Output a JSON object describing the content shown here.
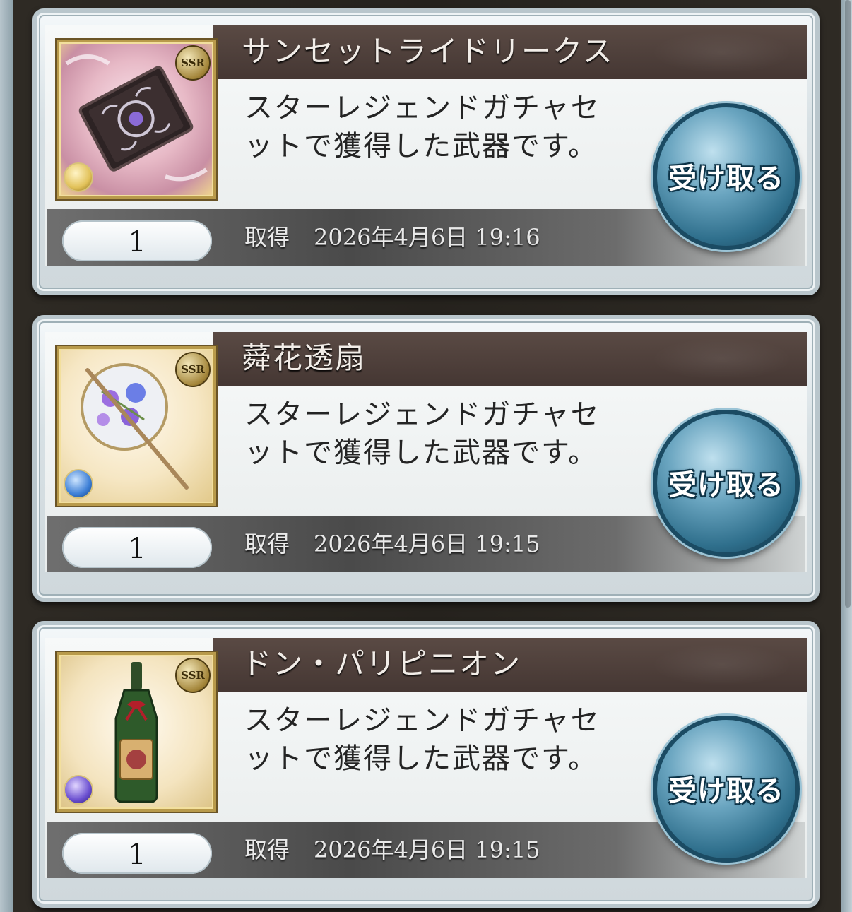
{
  "items": [
    {
      "name": "サンセットライドリークス",
      "description": "スターレジェンドガチャセットで獲得した武器です。",
      "quantity": "1",
      "obtained_label": "取得",
      "obtained_datetime": "2026年4月6日 19:16",
      "rarity": "SSR",
      "element_color": "#e2c25a",
      "icon": "book-icon",
      "button_label": "受け取る"
    },
    {
      "name": "蕣花透扇",
      "description": "スターレジェンドガチャセットで獲得した武器です。",
      "quantity": "1",
      "obtained_label": "取得",
      "obtained_datetime": "2026年4月6日 19:15",
      "rarity": "SSR",
      "element_color": "#3d7fd6",
      "icon": "fan-icon",
      "button_label": "受け取る"
    },
    {
      "name": "ドン・パリピニオン",
      "description": "スターレジェンドガチャセットで獲得した武器です。",
      "quantity": "1",
      "obtained_label": "取得",
      "obtained_datetime": "2026年4月6日 19:15",
      "rarity": "SSR",
      "element_color": "#6a4fd0",
      "icon": "bottle-icon",
      "button_label": "受け取る"
    }
  ]
}
